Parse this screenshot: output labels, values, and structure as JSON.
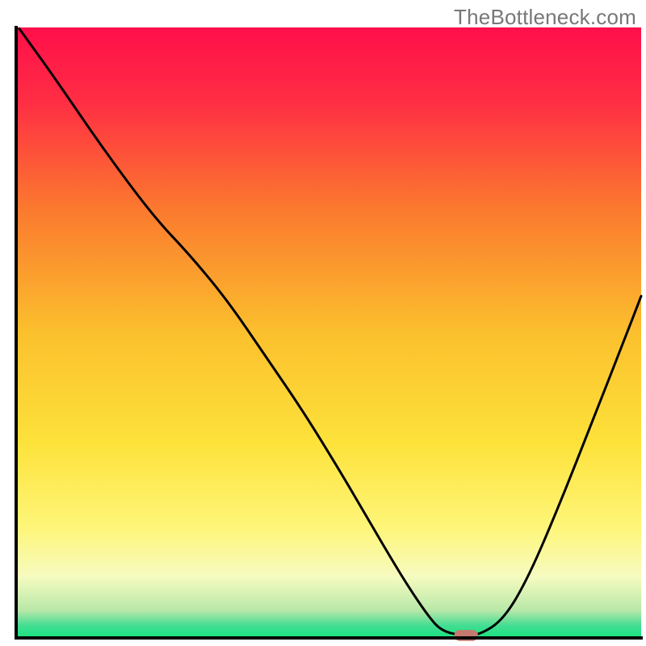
{
  "watermark": "TheBottleneck.com",
  "chart_data": {
    "type": "line",
    "title": "",
    "xlabel": "",
    "ylabel": "",
    "xlim": [
      0,
      100
    ],
    "ylim": [
      0,
      100
    ],
    "grid": false,
    "legend": false,
    "gradient": {
      "orientation": "vertical",
      "stops": [
        {
          "offset": 0.0,
          "color": "#ff0f4a"
        },
        {
          "offset": 0.12,
          "color": "#ff2d44"
        },
        {
          "offset": 0.3,
          "color": "#fb7a2e"
        },
        {
          "offset": 0.5,
          "color": "#fbc02d"
        },
        {
          "offset": 0.68,
          "color": "#fde23a"
        },
        {
          "offset": 0.82,
          "color": "#fef67a"
        },
        {
          "offset": 0.9,
          "color": "#f6fbc0"
        },
        {
          "offset": 0.955,
          "color": "#b8e8a8"
        },
        {
          "offset": 0.98,
          "color": "#42dd92"
        },
        {
          "offset": 1.0,
          "color": "#17e37e"
        }
      ]
    },
    "series": [
      {
        "name": "bottleneck-curve",
        "color": "#000000",
        "stroke_width": 3,
        "x": [
          0.5,
          6,
          14,
          22,
          28,
          34,
          40,
          46,
          52,
          56,
          60,
          63,
          66,
          68,
          71,
          74,
          78,
          82,
          87,
          92,
          97,
          100
        ],
        "y": [
          99.8,
          92,
          80,
          69,
          62.5,
          55,
          46,
          37,
          27,
          20,
          13,
          8,
          3.5,
          1.2,
          0.4,
          0.4,
          3,
          10,
          22,
          35,
          48,
          56
        ]
      }
    ],
    "marker": {
      "name": "optimal-point",
      "x": 72,
      "y": 0.4,
      "color": "#c47a6e",
      "width": 3.8,
      "height": 1.8
    },
    "axes": {
      "color": "#000000",
      "stroke_width": 4,
      "left": true,
      "bottom": true,
      "right": false,
      "top": false
    }
  }
}
